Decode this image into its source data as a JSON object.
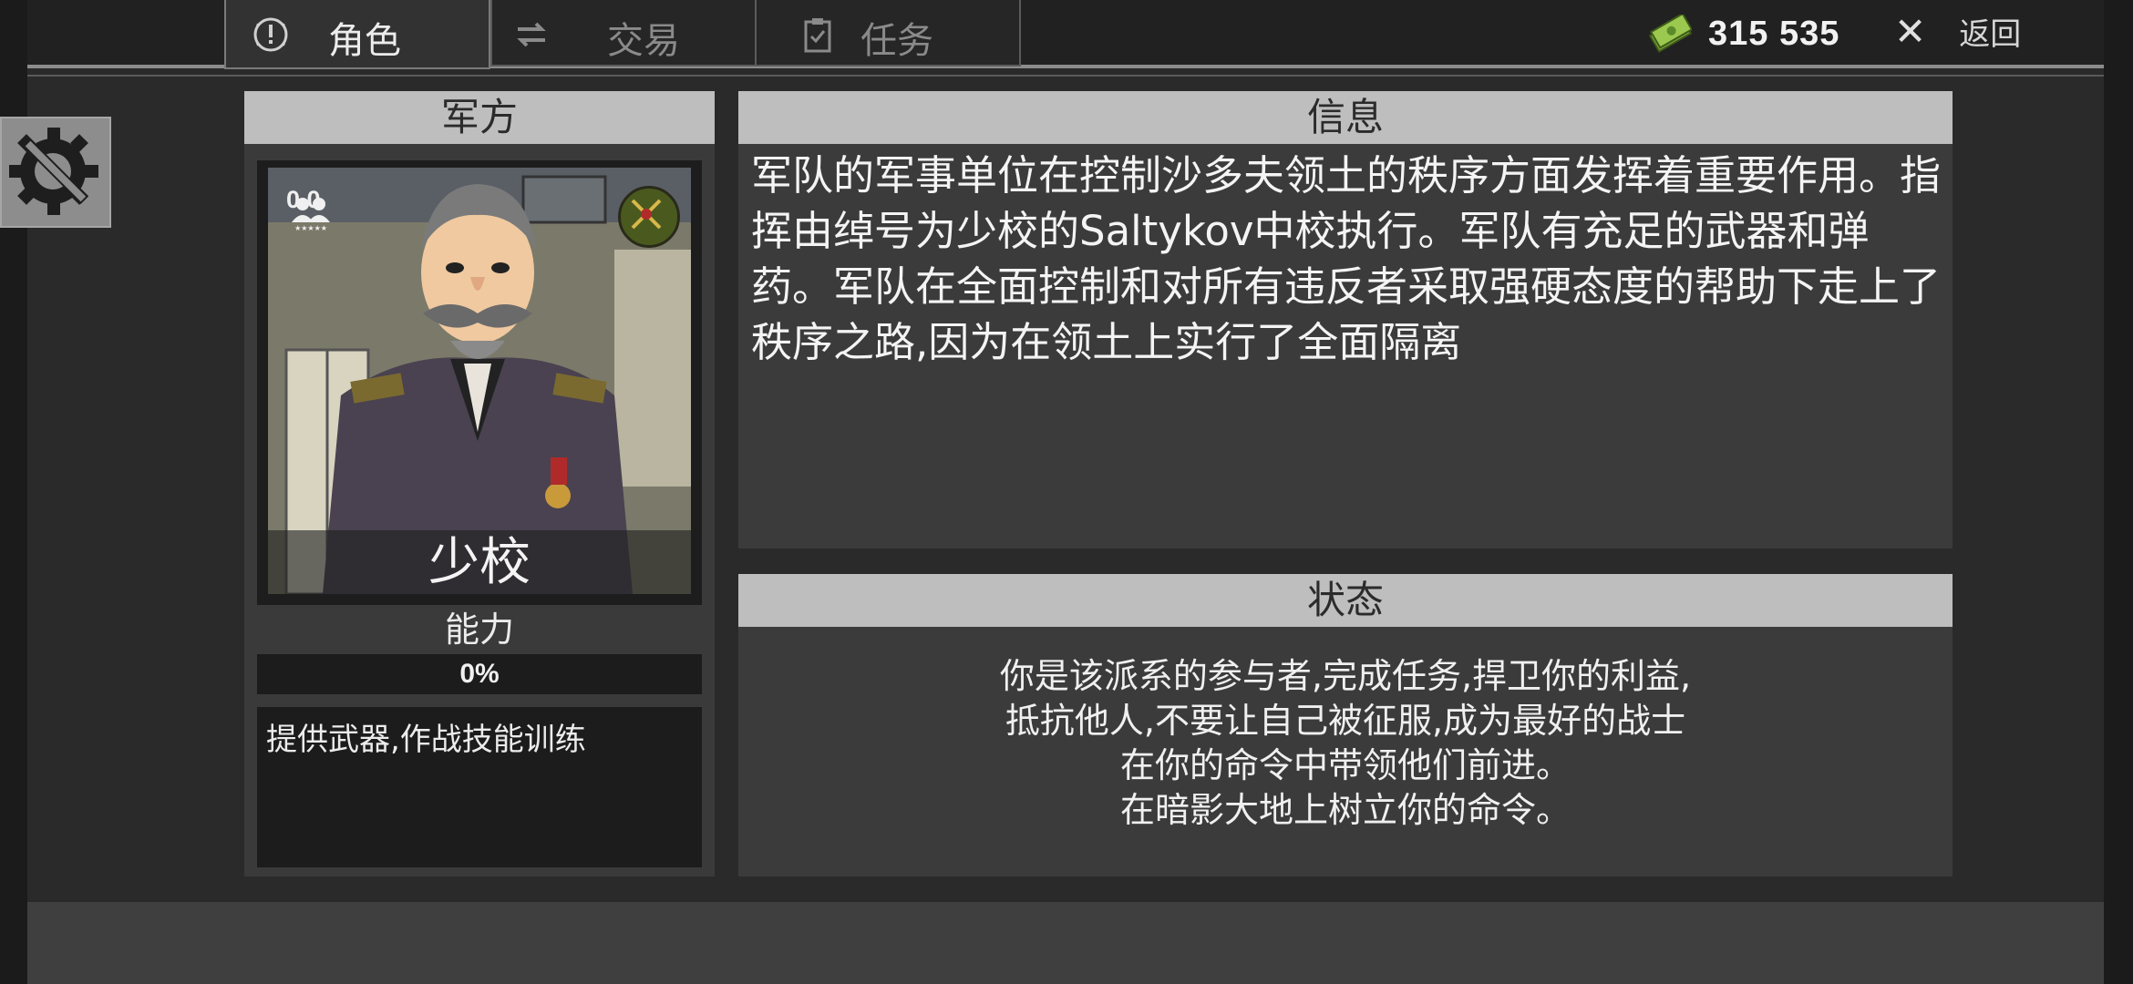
{
  "tabs": [
    {
      "label": "角色",
      "icon": "alert-icon",
      "active": true
    },
    {
      "label": "交易",
      "icon": "exchange-icon",
      "active": false
    },
    {
      "label": "任务",
      "icon": "clipboard-icon",
      "active": false
    }
  ],
  "currency": {
    "icon": "cash-icon",
    "amount": "315 535"
  },
  "back": {
    "icon": "close-icon",
    "label": "返回"
  },
  "settings": {
    "icon": "gear-wrench-icon"
  },
  "faction": {
    "header": "军方",
    "population_value": "0.0",
    "rank_caption": "少校",
    "ability_label": "能力",
    "ability_progress": "0%",
    "ability_fraction": 0,
    "description": "提供武器,作战技能训练"
  },
  "info": {
    "header": "信息",
    "text": "军队的军事单位在控制沙多夫领土的秩序方面发挥着重要作用。指挥由绰号为少校的Saltykov中校执行。军队有充足的武器和弹药。军队在全面控制和对所有违反者采取强硬态度的帮助下走上了秩序之路,因为在领土上实行了全面隔离"
  },
  "status": {
    "header": "状态",
    "lines": [
      "你是该派系的参与者,完成任务,捍卫你的利益,",
      "抵抗他人,不要让自己被征服,成为最好的战士",
      "在你的命令中带领他们前进。",
      "在暗影大地上树立你的命令。"
    ]
  },
  "colors": {
    "panel_header": "#bebebe",
    "panel_bg": "#3b3b3b",
    "accent_green": "#6b8a3a"
  }
}
